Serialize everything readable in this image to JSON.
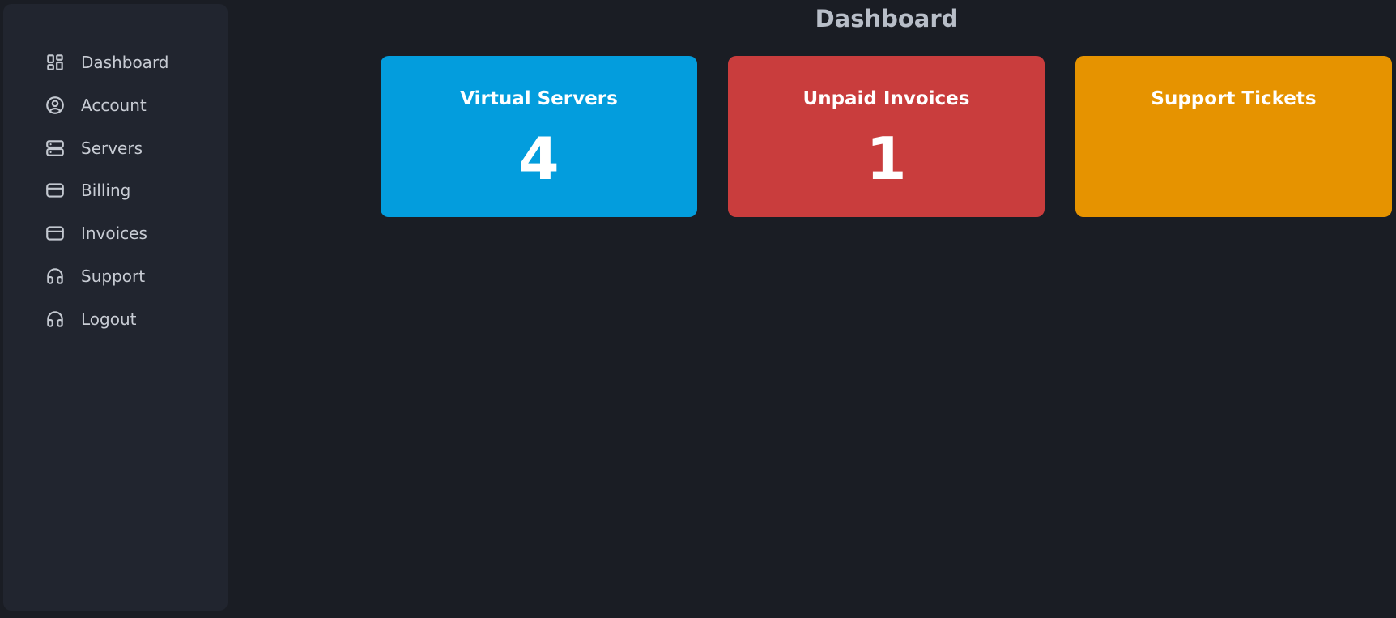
{
  "sidebar": {
    "items": [
      {
        "label": "Dashboard",
        "icon": "dashboard-icon"
      },
      {
        "label": "Account",
        "icon": "user-circle-icon"
      },
      {
        "label": "Servers",
        "icon": "server-icon"
      },
      {
        "label": "Billing",
        "icon": "credit-card-icon"
      },
      {
        "label": "Invoices",
        "icon": "credit-card-icon"
      },
      {
        "label": "Support",
        "icon": "headphones-icon"
      },
      {
        "label": "Logout",
        "icon": "headphones-icon"
      }
    ]
  },
  "page": {
    "title": "Dashboard"
  },
  "cards": [
    {
      "title": "Virtual Servers",
      "value": "4",
      "color": "#039ddd"
    },
    {
      "title": "Unpaid Invoices",
      "value": "1",
      "color": "#c93d3d"
    },
    {
      "title": "Support Tickets",
      "value": "",
      "color": "#e69300"
    }
  ],
  "colors": {
    "background": "#1a1d24",
    "sidebar": "#21252f",
    "nav_text": "#c8ccd4",
    "title_text": "#b8bec8"
  }
}
